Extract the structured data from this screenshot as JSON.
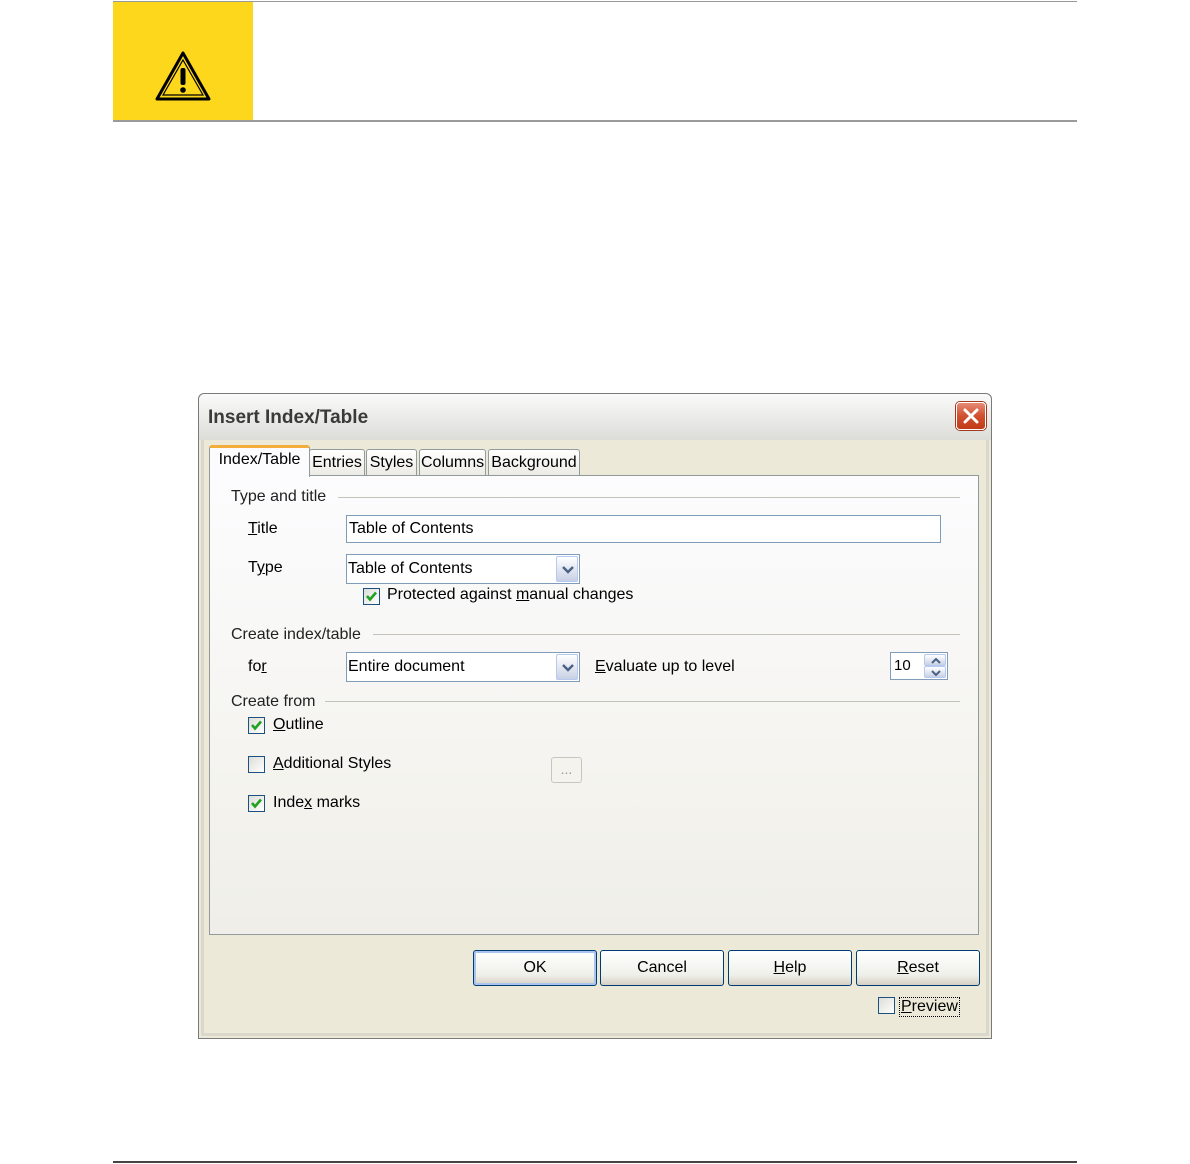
{
  "document": {
    "warning_icon": "warning-triangle-icon"
  },
  "dialog": {
    "title": "Insert Index/Table",
    "close_icon": "close-icon",
    "tabs": [
      {
        "label": "Index/Table",
        "active": true
      },
      {
        "label": "Entries",
        "active": false
      },
      {
        "label": "Styles",
        "active": false
      },
      {
        "label": "Columns",
        "active": false
      },
      {
        "label": "Background",
        "active": false
      }
    ],
    "type_and_title": {
      "heading": "Type and title",
      "title_label": "Title",
      "title_value": "Table of Contents",
      "type_label": "Type",
      "type_value": "Table of Contents",
      "protected_label": "Protected against manual changes",
      "protected_checked": true
    },
    "create_index": {
      "heading": "Create index/table",
      "for_label": "for",
      "for_value": "Entire document",
      "evaluate_label": "Evaluate up to level",
      "evaluate_value": "10"
    },
    "create_from": {
      "heading": "Create from",
      "outline_label": "Outline",
      "outline_checked": true,
      "additional_styles_label": "Additional Styles",
      "additional_styles_checked": false,
      "ellipsis_label": "...",
      "index_marks_label": "Index marks",
      "index_marks_checked": true
    },
    "buttons": {
      "ok": "OK",
      "cancel": "Cancel",
      "help": "Help",
      "reset": "Reset"
    },
    "preview_label": "Preview",
    "preview_checked": false
  }
}
